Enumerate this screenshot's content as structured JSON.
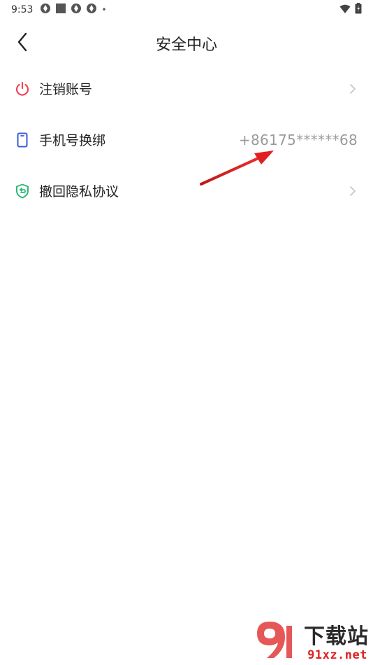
{
  "status_bar": {
    "time": "9:53",
    "dot": "•",
    "icons": [
      "app-icon",
      "square-icon",
      "app-icon",
      "app-icon"
    ],
    "right_icons": [
      "wifi-icon",
      "battery-icon"
    ]
  },
  "header": {
    "title": "安全中心",
    "back_icon": "chevron-left-icon"
  },
  "items": [
    {
      "label": "注销账号",
      "icon": "power-icon",
      "icon_color": "#f0465a",
      "value": "",
      "chevron": true
    },
    {
      "label": "手机号换绑",
      "icon": "phone-icon",
      "icon_color": "#3c5ad6",
      "value": "+86175******68",
      "chevron": false
    },
    {
      "label": "撤回隐私协议",
      "icon": "shield-icon",
      "icon_color": "#2fb879",
      "value": "",
      "chevron": true
    }
  ],
  "watermark": {
    "title": "下载站",
    "url": "91xz.net"
  },
  "colors": {
    "accent_red": "#e02020",
    "text_primary": "#222222",
    "text_secondary": "#9a9a9a"
  }
}
